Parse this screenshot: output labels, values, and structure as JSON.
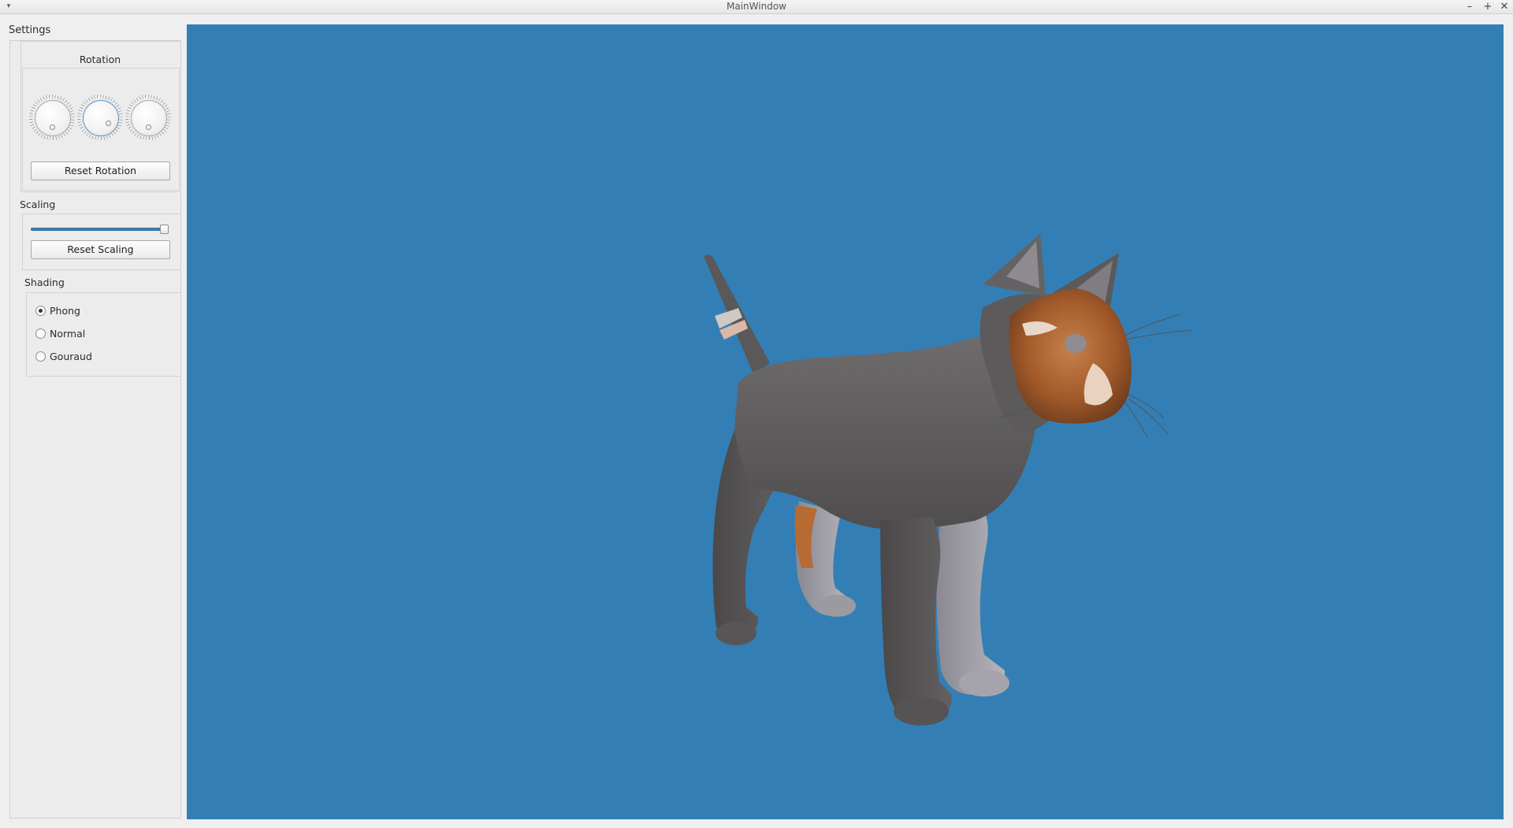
{
  "window": {
    "title": "MainWindow",
    "menu_glyph": "▾",
    "minimize_glyph": "–",
    "maximize_glyph": "+",
    "close_glyph": "✕"
  },
  "settings": {
    "title": "Settings",
    "rotation": {
      "title": "Rotation",
      "dials": [
        "x-rotation",
        "y-rotation",
        "z-rotation"
      ],
      "reset_label": "Reset Rotation"
    },
    "scaling": {
      "title": "Scaling",
      "slider_value": 1.0,
      "reset_label": "Reset Scaling"
    },
    "shading": {
      "title": "Shading",
      "options": [
        "Phong",
        "Normal",
        "Gouraud"
      ],
      "selected": "Phong"
    }
  },
  "viewport": {
    "background_color": "#337fb5",
    "model": "cat"
  }
}
